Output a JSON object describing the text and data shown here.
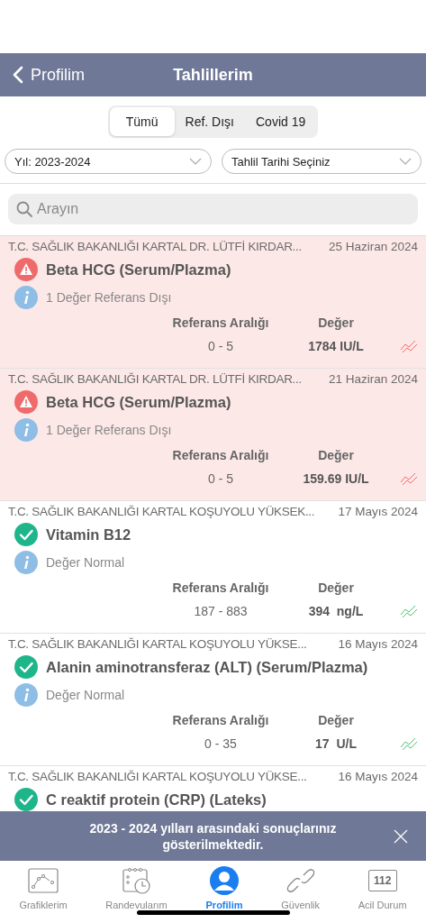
{
  "nav_bar": {
    "back_label": "Profilim",
    "title": "Tahlillerim"
  },
  "segments": [
    {
      "label": "Tümü",
      "selected": true
    },
    {
      "label": "Ref. Dışı",
      "selected": false
    },
    {
      "label": "Covid 19",
      "selected": false
    }
  ],
  "filters": [
    {
      "value": "Yıl: 2023-2024"
    },
    {
      "value": "Tahlil Tarihi Seçiniz"
    }
  ],
  "search": {
    "placeholder": "Arayın"
  },
  "results": [
    {
      "hospital": "T.C. SAĞLIK BAKANLIĞI KARTAL DR. LÜTFİ KIRDAR...",
      "date": "25 Haziran 2024",
      "kind": "abnormal",
      "test": "Beta HCG (Serum/Plazma)",
      "note": "1 Değer Referans Dışı",
      "range_label": "Referans Aralığı",
      "value_label": "Değer",
      "range": "0 - 5",
      "value": "1784 IU/L"
    },
    {
      "hospital": "T.C. SAĞLIK BAKANLIĞI KARTAL DR. LÜTFİ KIRDAR...",
      "date": "21 Haziran 2024",
      "kind": "abnormal",
      "test": "Beta HCG (Serum/Plazma)",
      "note": "1 Değer Referans Dışı",
      "range_label": "Referans Aralığı",
      "value_label": "Değer",
      "range": "0 - 5",
      "value": "159.69 IU/L"
    },
    {
      "hospital": "T.C. SAĞLIK BAKANLIĞI KARTAL KOŞUYOLU YÜKSEK...",
      "date": "17 Mayıs 2024",
      "kind": "normal",
      "test": "Vitamin B12",
      "note": "Değer Normal",
      "range_label": "Referans Aralığı",
      "value_label": "Değer",
      "range": "187 - 883",
      "value": "394  ng/L"
    },
    {
      "hospital": "T.C. SAĞLIK BAKANLIĞI KARTAL KOŞUYOLU YÜKSE...",
      "date": "16 Mayıs 2024",
      "kind": "normal",
      "test": "Alanin aminotransferaz (ALT) (Serum/Plazma)",
      "note": "Değer Normal",
      "range_label": "Referans Aralığı",
      "value_label": "Değer",
      "range": "0 - 35",
      "value": "17  U/L"
    },
    {
      "hospital": "T.C. SAĞLIK BAKANLIĞI KARTAL KOŞUYOLU YÜKSE...",
      "date": "16 Mayıs 2024",
      "kind": "normal",
      "test": "C reaktif protein (CRP) (Lateks)"
    }
  ],
  "banner": {
    "message": "2023 - 2024 yılları arasındaki sonuçlarınız gösterilmektedir."
  },
  "tab_bar": [
    {
      "kind": "chart",
      "label": "Grafiklerim",
      "selected": false
    },
    {
      "kind": "calendar",
      "label": "Randevularım",
      "selected": false
    },
    {
      "kind": "profile",
      "label": "Profilim",
      "selected": true
    },
    {
      "kind": "link",
      "label": "Güvenlik",
      "selected": false
    },
    {
      "kind": "emergency",
      "label": "Acil Durum",
      "icon_text": "112",
      "selected": false
    }
  ]
}
